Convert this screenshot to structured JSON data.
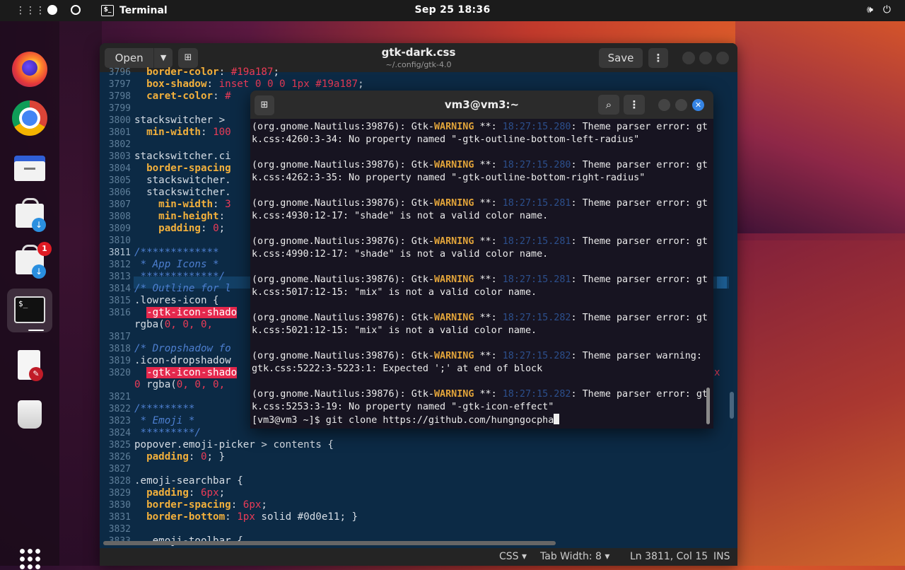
{
  "topbar": {
    "app_name": "Terminal",
    "clock": "Sep 25  18:36",
    "volume_icon": "🕪",
    "power_icon": "⏻"
  },
  "dock": {
    "badge_count": "1",
    "items": [
      "firefox",
      "chrome",
      "files",
      "software-store",
      "software-updater",
      "terminal",
      "text-editor",
      "trash",
      "show-apps"
    ]
  },
  "editor": {
    "open_label": "Open",
    "title": "gtk-dark.css",
    "subtitle": "~/.config/gtk-4.0",
    "save_label": "Save",
    "status": {
      "language": "CSS",
      "tab_width": "Tab Width: 8",
      "position": "Ln 3811, Col 15",
      "mode": "INS"
    },
    "line_numbers": [
      "3796",
      "3797",
      "3798",
      "3799",
      "3800",
      "3801",
      "3802",
      "3803",
      "3804",
      "3805",
      "3806",
      "3807",
      "3808",
      "3809",
      "3810",
      "3811",
      "3812",
      "3813",
      "3814",
      "3815",
      "3816",
      "",
      "3817",
      "3818",
      "3819",
      "3820",
      "",
      "3821",
      "3822",
      "3823",
      "3824",
      "3825",
      "3826",
      "3827",
      "3828",
      "3829",
      "3830",
      "3831",
      "3832",
      "3833"
    ],
    "code": {
      "l3796_prop": "border-color",
      "l3796_val": "#19a187",
      "l3797_prop": "box-shadow",
      "l3797_val": "inset 0 0 0 1px #19a187",
      "l3798_prop": "caret-color",
      "l3798_val": "#",
      "l3800": "stackswitcher > ",
      "l3801_prop": "min-width",
      "l3801_val": "100",
      "l3803": "stackswitcher.ci",
      "l3804_prop": "border-spacing",
      "l3805": "  stackswitcher.",
      "l3806": "  stackswitcher.",
      "l3807_prop": "min-width",
      "l3807_val": "3",
      "l3808_prop": "min-height",
      "l3809_prop": "padding",
      "l3809_val": "0",
      "l3811": "/*************",
      "l3812": " * App Icons *",
      "l3813": " *************/",
      "l3814": "/* Outline for l",
      "l3815": ".lowres-icon {",
      "l3816": "-gtk-icon-shado",
      "l3816b_a": "rgba(",
      "l3816b_b": "0, 0, 0,",
      "l3818": "/* Dropshadow fo",
      "l3819": ".icon-dropshadow",
      "l3820": "-gtk-icon-shado",
      "l3820b_a": "0",
      "l3820b_b": " rgba(",
      "l3820b_c": "0, 0, 0,",
      "l3822": "/*********",
      "l3823": " * Emoji *",
      "l3824": " *********/",
      "l3825_a": "popover.emoji-picker",
      "l3825_b": " > ",
      "l3825_c": "contents {",
      "l3826_prop": "padding",
      "l3826_val": "0",
      "l3828": ".emoji-searchbar {",
      "l3829_prop": "padding",
      "l3829_val": "6px",
      "l3830_prop": "border-spacing",
      "l3830_val": "6px",
      "l3831_prop": "border-bottom",
      "l3831_val_a": "1px",
      "l3831_val_b": " solid #0d0e11; }",
      "l3833": "  .emoji-toolbar {"
    }
  },
  "terminal": {
    "title": "vm3@vm3:~",
    "lines": [
      {
        "pre": "(org.gnome.Nautilus:39876): Gtk-",
        "warn": "WARNING",
        "mid": " **: ",
        "ts": "18:27:15.280",
        "post": ": Theme parser error: gt",
        "cont": "k.css:4260:3-34: No property named \"-gtk-outline-bottom-left-radius\""
      },
      {
        "pre": "(org.gnome.Nautilus:39876): Gtk-",
        "warn": "WARNING",
        "mid": " **: ",
        "ts": "18:27:15.280",
        "post": ": Theme parser error: gt",
        "cont": "k.css:4262:3-35: No property named \"-gtk-outline-bottom-right-radius\""
      },
      {
        "pre": "(org.gnome.Nautilus:39876): Gtk-",
        "warn": "WARNING",
        "mid": " **: ",
        "ts": "18:27:15.281",
        "post": ": Theme parser error: gt",
        "cont": "k.css:4930:12-17: \"shade\" is not a valid color name."
      },
      {
        "pre": "(org.gnome.Nautilus:39876): Gtk-",
        "warn": "WARNING",
        "mid": " **: ",
        "ts": "18:27:15.281",
        "post": ": Theme parser error: gt",
        "cont": "k.css:4990:12-17: \"shade\" is not a valid color name."
      },
      {
        "pre": "(org.gnome.Nautilus:39876): Gtk-",
        "warn": "WARNING",
        "mid": " **: ",
        "ts": "18:27:15.281",
        "post": ": Theme parser error: gt",
        "cont": "k.css:5017:12-15: \"mix\" is not a valid color name."
      },
      {
        "pre": "(org.gnome.Nautilus:39876): Gtk-",
        "warn": "WARNING",
        "mid": " **: ",
        "ts": "18:27:15.282",
        "post": ": Theme parser error: gt",
        "cont": "k.css:5021:12-15: \"mix\" is not a valid color name."
      },
      {
        "pre": "(org.gnome.Nautilus:39876): Gtk-",
        "warn": "WARNING",
        "mid": " **: ",
        "ts": "18:27:15.282",
        "post": ": Theme parser warning:",
        "cont": "gtk.css:5222:3-5223:1: Expected ';' at end of block"
      },
      {
        "pre": "(org.gnome.Nautilus:39876): Gtk-",
        "warn": "WARNING",
        "mid": " **: ",
        "ts": "18:27:15.282",
        "post": ": Theme parser error: gt",
        "cont": "k.css:5253:3-19: No property named \"-gtk-icon-effect\""
      }
    ],
    "prompt": "[vm3@vm3 ~]$ git clone https://github.com/hungngocpha"
  }
}
